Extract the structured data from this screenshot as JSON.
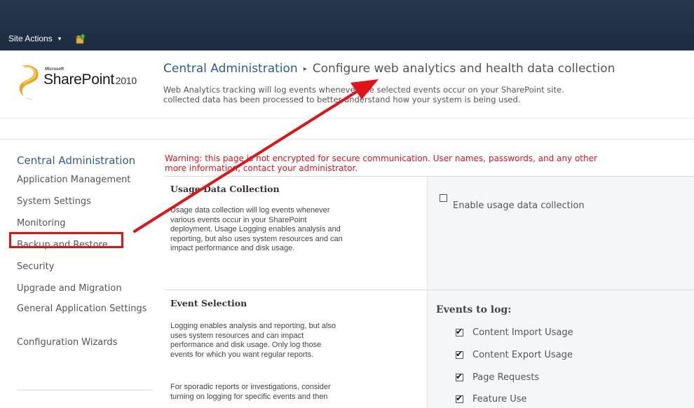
{
  "topbar": {
    "site_actions": "Site Actions",
    "site_actions_caret": "▾"
  },
  "logo": {
    "brand": "Microsoft",
    "product": "SharePoint",
    "version": "2010"
  },
  "breadcrumb": {
    "root": "Central Administration",
    "separator": "▸",
    "current": "Configure web analytics and health data collection"
  },
  "page_description": {
    "line1": "Web Analytics tracking will log events whenever the selected events occur on your SharePoint site.",
    "line2": "collected data has been processed to better understand how your system is being used."
  },
  "quicklaunch": {
    "heading": "Central Administration",
    "items": [
      "Application Management",
      "System Settings",
      "Monitoring",
      "Backup and Restore",
      "Security",
      "Upgrade and Migration",
      "General Application Settings",
      "Configuration Wizards"
    ]
  },
  "warning": {
    "line1": "Warning: this page is not encrypted for secure communication. User names, passwords, and any other",
    "line2": "more information, contact your administrator."
  },
  "usage_section": {
    "title": "Usage Data Collection",
    "description": [
      "Usage data collection will log events whenever",
      "various events occur in your SharePoint",
      "deployment. Usage Logging enables analysis and",
      "reporting, but also uses system resources and can",
      "impact performance and disk usage."
    ],
    "enable_label": "Enable usage data collection",
    "enable_checked": false
  },
  "event_section": {
    "title": "Event Selection",
    "description": [
      "Logging enables analysis and reporting, but also",
      "uses system resources and can impact",
      "performance and disk usage. Only log those",
      "events for which you want regular reports."
    ],
    "description2": [
      "For sporadic reports or investigations, consider",
      "turning on logging for specific events and then"
    ],
    "events_title": "Events to log:",
    "events": [
      {
        "label": "Content Import Usage",
        "checked": true
      },
      {
        "label": "Content Export Usage",
        "checked": true
      },
      {
        "label": "Page Requests",
        "checked": true
      },
      {
        "label": "Feature Use",
        "checked": true
      }
    ]
  },
  "colors": {
    "topbar": "#1f3148",
    "link_blue": "#2a5d9b",
    "warning_red": "#e0141a",
    "annotation_red": "#e01418"
  }
}
